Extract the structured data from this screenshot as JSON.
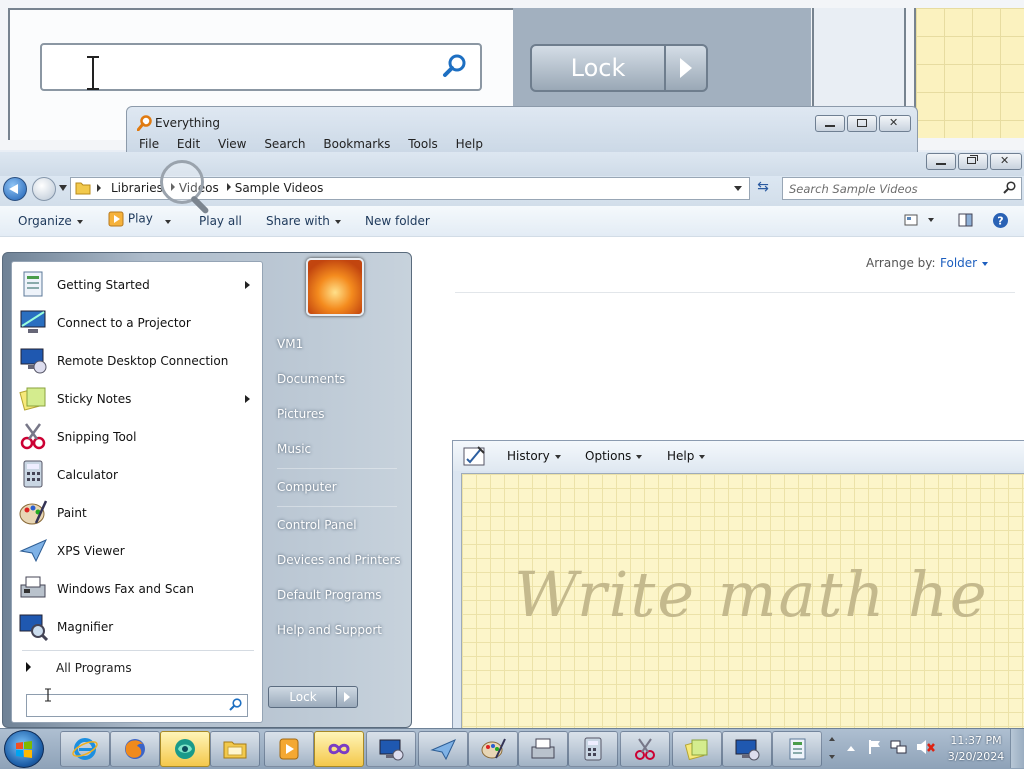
{
  "everything": {
    "title": "Everything",
    "menu": [
      "File",
      "Edit",
      "View",
      "Search",
      "Bookmarks",
      "Tools",
      "Help"
    ]
  },
  "zoom": {
    "lock_label": "Lock"
  },
  "explorer": {
    "breadcrumb": [
      "Libraries",
      "Videos",
      "Sample Videos"
    ],
    "search_placeholder": "Search Sample Videos",
    "toolbar": {
      "organize": "Organize",
      "play": "Play",
      "play_all": "Play all",
      "share_with": "Share with",
      "new_folder": "New folder"
    },
    "arrange_label": "Arrange by:",
    "arrange_value": "Folder"
  },
  "startmenu": {
    "programs": [
      {
        "label": "Getting Started",
        "icon": "getting-started-icon",
        "submenu": true
      },
      {
        "label": "Connect to a Projector",
        "icon": "projector-icon",
        "submenu": false
      },
      {
        "label": "Remote Desktop Connection",
        "icon": "remote-desktop-icon",
        "submenu": false
      },
      {
        "label": "Sticky Notes",
        "icon": "sticky-notes-icon",
        "submenu": true
      },
      {
        "label": "Snipping Tool",
        "icon": "snipping-tool-icon",
        "submenu": false
      },
      {
        "label": "Calculator",
        "icon": "calculator-icon",
        "submenu": false
      },
      {
        "label": "Paint",
        "icon": "paint-icon",
        "submenu": false
      },
      {
        "label": "XPS Viewer",
        "icon": "xps-viewer-icon",
        "submenu": false
      },
      {
        "label": "Windows Fax and Scan",
        "icon": "fax-scan-icon",
        "submenu": false
      },
      {
        "label": "Magnifier",
        "icon": "magnifier-icon",
        "submenu": false
      }
    ],
    "all_programs": "All Programs",
    "right_links": [
      "VM1",
      "Documents",
      "Pictures",
      "Music",
      "Computer",
      "Control Panel",
      "Devices and Printers",
      "Default Programs",
      "Help and Support"
    ],
    "lock_label": "Lock"
  },
  "math_panel": {
    "menu": [
      "History",
      "Options",
      "Help"
    ],
    "hint": "Write math he"
  },
  "taskbar": {
    "apps": [
      "internet-explorer-icon",
      "firefox-icon",
      "browser-icon",
      "explorer-icon",
      "media-player-icon",
      "infinity-app-icon",
      "remote-desktop-icon",
      "xps-viewer-icon",
      "paint-icon",
      "fax-scan-icon",
      "calculator-icon",
      "snipping-tool-icon",
      "sticky-notes-icon",
      "remote-desktop-icon",
      "getting-started-icon"
    ],
    "active_index": 2,
    "time": "11:37 PM",
    "date": "3/20/2024"
  }
}
